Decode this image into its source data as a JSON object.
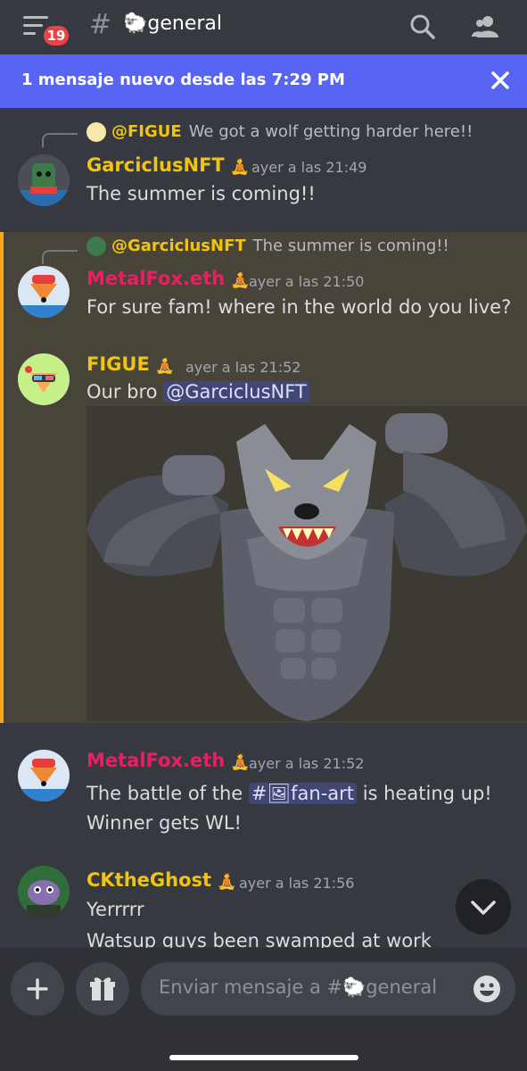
{
  "header": {
    "unread_badge": "19",
    "channel_name": "🐑general"
  },
  "banner": {
    "text": "1 mensaje nuevo desde las 7:29 PM"
  },
  "messages": [
    {
      "reply_name": "@FIGUE",
      "reply_text": "We got a wolf getting harder here!!",
      "author": "GarciclusNFT",
      "author_color": "#f1c40f",
      "time": "ayer a las 21:49",
      "lines": [
        "The summer is coming!!"
      ]
    },
    {
      "reply_name": "@GarciclusNFT",
      "reply_text": "The summer is coming!!",
      "author": "MetalFox.eth",
      "author_color": "#e91e63",
      "time": "ayer a las 21:50",
      "lines": [
        "For sure fam! where in the world do you live?"
      ]
    },
    {
      "author": "FIGUE",
      "author_color": "#f1c40f",
      "time": "ayer a las 21:52",
      "text_prefix": "Our bro ",
      "mention": "@GarciclusNFT"
    },
    {
      "author": "MetalFox.eth",
      "author_color": "#e91e63",
      "time": "ayer a las 21:52",
      "line1_prefix": "The battle of the ",
      "channel_mention": "#🖼fan-art",
      "line1_suffix": " is heating up!",
      "line2": "Winner gets WL!"
    },
    {
      "author": "CKtheGhost",
      "author_color": "#f1c40f",
      "time": "ayer a las 21:56",
      "lines": [
        "Yerrrrr",
        "Watsup guys been swamped at work"
      ]
    }
  ],
  "flame_icon": "🧘",
  "composer": {
    "placeholder": "Enviar mensaje a #🐑general"
  }
}
